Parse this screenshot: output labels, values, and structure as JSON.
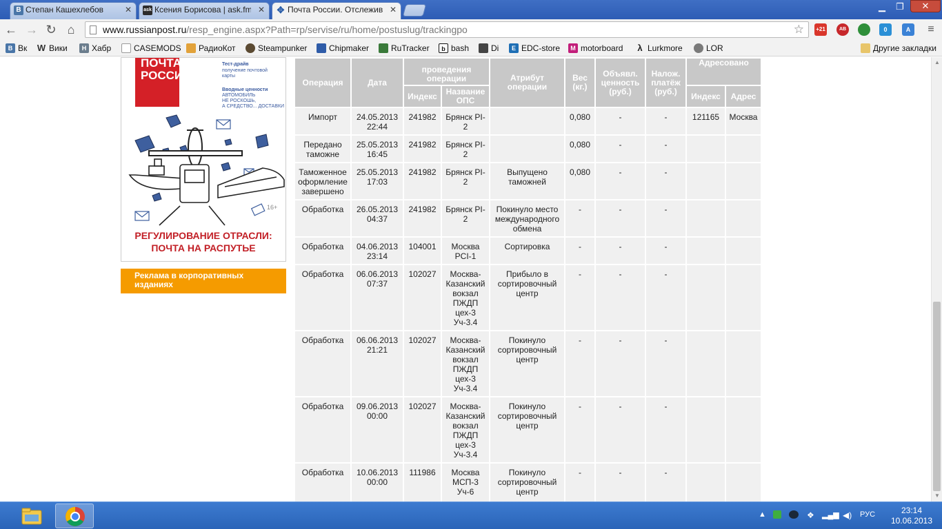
{
  "tabs": [
    {
      "label": "Степан Кашехлебов",
      "favicon": "vk-icon",
      "favicon_text": "B",
      "color": "#4a76a8"
    },
    {
      "label": "Ксения Борисова | ask.fm",
      "favicon": "askfm-icon",
      "favicon_text": "ask",
      "color": "#2c2c2c"
    },
    {
      "label": "Почта России. Отслежив",
      "favicon": "russianpost-icon",
      "favicon_text": "",
      "color": "#2a5da8"
    }
  ],
  "toolbar": {
    "url_host": "www.russianpost.ru",
    "url_path": "/resp_engine.aspx?Path=rp/servise/ru/home/postuslug/trackingpo"
  },
  "extensions": [
    {
      "name": "counter-badge-icon",
      "text": "+21",
      "color": "#d9362b"
    },
    {
      "name": "adblock-icon",
      "text": "AB",
      "color": "#c7282b"
    },
    {
      "name": "rss-icon",
      "text": "",
      "color": "#2f8f3a"
    },
    {
      "name": "skype-icon",
      "text": "0",
      "color": "#2a8fd6"
    },
    {
      "name": "translate-icon",
      "text": "A",
      "color": "#3b82d6"
    }
  ],
  "bookmarks": {
    "items": [
      {
        "label": "Вк",
        "icon_text": "B",
        "color": "#4a76a8"
      },
      {
        "label": "Вики",
        "icon_text": "W",
        "color": "#555555"
      },
      {
        "label": "Хабр",
        "icon_text": "H",
        "color": "#6b7d8d"
      },
      {
        "label": "CASEMODS",
        "icon_text": "",
        "color": "#cccccc"
      },
      {
        "label": "РадиоКот",
        "icon_text": "",
        "color": "#e2a23a"
      },
      {
        "label": "Steampunker",
        "icon_text": "",
        "color": "#5b4a32"
      },
      {
        "label": "Chipmaker",
        "icon_text": "",
        "color": "#2f5ca8"
      },
      {
        "label": "RuTracker",
        "icon_text": "",
        "color": "#3a7a3a"
      },
      {
        "label": "bash",
        "icon_text": "b",
        "color": "#111111"
      },
      {
        "label": "Di",
        "icon_text": "",
        "color": "#444444"
      },
      {
        "label": "EDC-store",
        "icon_text": "E",
        "color": "#1f6fb5"
      },
      {
        "label": "motorboard",
        "icon_text": "M",
        "color": "#c21e7a"
      },
      {
        "label": "Lurkmore",
        "icon_text": "",
        "color": "#222222"
      },
      {
        "label": "LOR",
        "icon_text": "",
        "color": "#7a7a7a"
      }
    ],
    "other": "Другие закладки"
  },
  "ad": {
    "logo_line1": "ПОЧТА",
    "logo_line2": "РОССИИ",
    "note1": "Тест-драйв",
    "note2": "получение почтовой",
    "note3": "карты",
    "note4": "Вводные ценности",
    "note5": "АВТОМОБИЛЬ",
    "note6": "НЕ РОСКОШЬ,",
    "note7": "А СРЕДСТВО... ДОСТАВКИ",
    "age": "16+",
    "headline1": "РЕГУЛИРОВАНИЕ ОТРАСЛИ:",
    "headline2": "ПОЧТА НА РАСПУТЬЕ",
    "button_line1": "Реклама в корпоративных",
    "button_line2": "изданиях"
  },
  "table": {
    "headers": {
      "operation": "Операция",
      "date": "Дата",
      "place_top": "проведения операции",
      "index": "Индекс",
      "ops_name": "Название ОПС",
      "attribute": "Атрибут операции",
      "weight": "Вес (кг.)",
      "declared": "Объявл. ценность (руб.)",
      "cod": "Налож. платёж (руб.)",
      "addressed": "Адресовано",
      "addr_index": "Индекс",
      "addr_address": "Адрес"
    },
    "rows": [
      {
        "op": "Импорт",
        "date": "24.05.2013 22:44",
        "index": "241982",
        "ops": "Брянск PI-2",
        "attr": "",
        "weight": "0,080",
        "declared": "-",
        "cod": "-",
        "addr_index": "121165",
        "addr": "Москва"
      },
      {
        "op": "Передано таможне",
        "date": "25.05.2013 16:45",
        "index": "241982",
        "ops": "Брянск PI-2",
        "attr": "",
        "weight": "0,080",
        "declared": "-",
        "cod": "-",
        "addr_index": "",
        "addr": ""
      },
      {
        "op": "Таможенное оформление завершено",
        "date": "25.05.2013 17:03",
        "index": "241982",
        "ops": "Брянск PI-2",
        "attr": "Выпущено таможней",
        "weight": "0,080",
        "declared": "-",
        "cod": "-",
        "addr_index": "",
        "addr": ""
      },
      {
        "op": "Обработка",
        "date": "26.05.2013 04:37",
        "index": "241982",
        "ops": "Брянск PI-2",
        "attr": "Покинуло место международного обмена",
        "weight": "-",
        "declared": "-",
        "cod": "-",
        "addr_index": "",
        "addr": ""
      },
      {
        "op": "Обработка",
        "date": "04.06.2013 23:14",
        "index": "104001",
        "ops": "Москва PCI-1",
        "attr": "Сортировка",
        "weight": "-",
        "declared": "-",
        "cod": "-",
        "addr_index": "",
        "addr": ""
      },
      {
        "op": "Обработка",
        "date": "06.06.2013 07:37",
        "index": "102027",
        "ops": "Москва-Казанский вокзал ПЖДП цех-3 Уч-3.4",
        "attr": "Прибыло в сортировочный центр",
        "weight": "-",
        "declared": "-",
        "cod": "-",
        "addr_index": "",
        "addr": ""
      },
      {
        "op": "Обработка",
        "date": "06.06.2013 21:21",
        "index": "102027",
        "ops": "Москва-Казанский вокзал ПЖДП цех-3 Уч-3.4",
        "attr": "Покинуло сортировочный центр",
        "weight": "-",
        "declared": "-",
        "cod": "-",
        "addr_index": "",
        "addr": ""
      },
      {
        "op": "Обработка",
        "date": "09.06.2013 00:00",
        "index": "102027",
        "ops": "Москва-Казанский вокзал ПЖДП цех-3 Уч-3.4",
        "attr": "Покинуло сортировочный центр",
        "weight": "-",
        "declared": "-",
        "cod": "-",
        "addr_index": "",
        "addr": ""
      },
      {
        "op": "Обработка",
        "date": "10.06.2013 00:00",
        "index": "111986",
        "ops": "Москва МСП-3 Уч-6",
        "attr": "Покинуло сортировочный центр",
        "weight": "-",
        "declared": "-",
        "cod": "-",
        "addr_index": "",
        "addr": ""
      }
    ]
  },
  "taskbar": {
    "lang": "РУС",
    "time": "23:14",
    "date": "10.06.2013"
  }
}
